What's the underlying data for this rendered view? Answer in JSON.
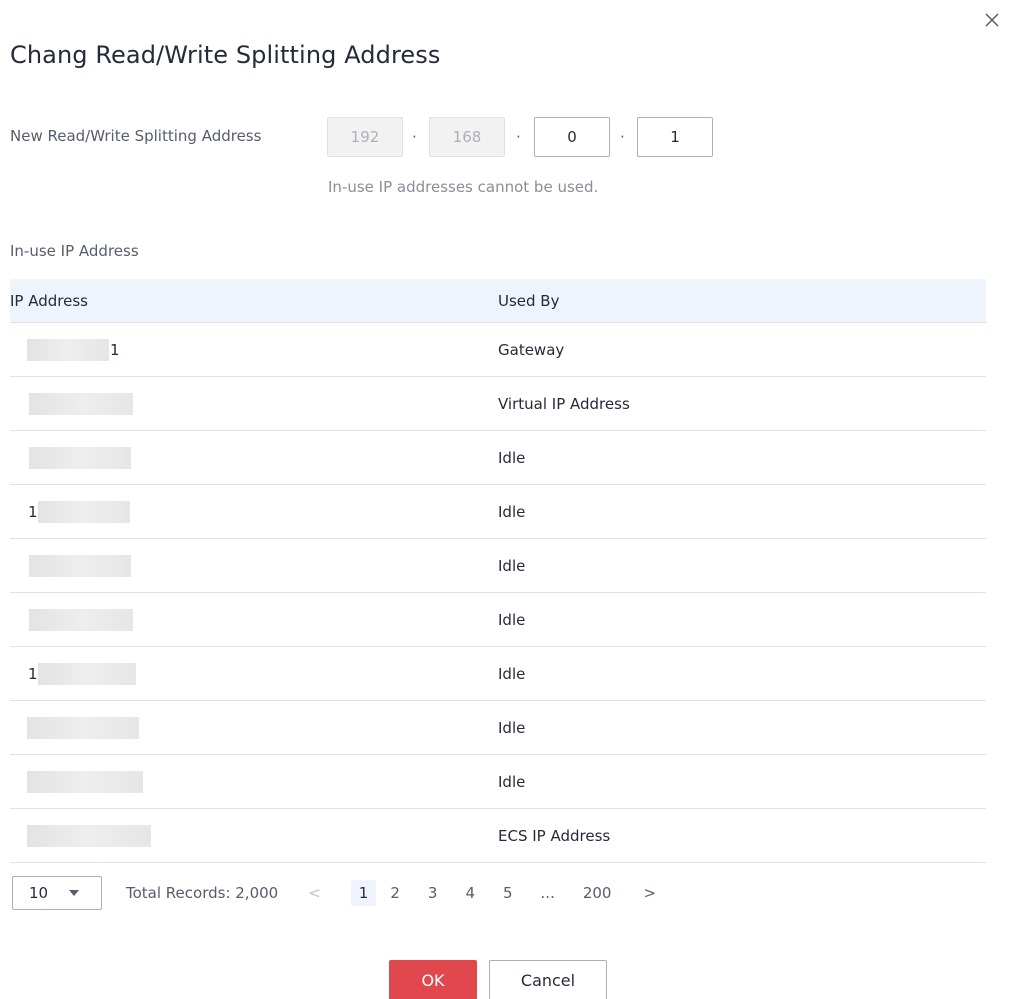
{
  "dialog": {
    "title": "Chang Read/Write Splitting Address",
    "close_icon": "close-icon"
  },
  "address_field": {
    "label": "New Read/Write Splitting Address",
    "octets": [
      "192",
      "168",
      "0",
      "1"
    ],
    "separator": "·",
    "hint": "In-use IP addresses cannot be used."
  },
  "inuse_section": {
    "label": "In-use IP Address"
  },
  "table": {
    "headers": [
      "IP Address",
      "Used By"
    ],
    "rows": [
      {
        "ip_visible": "1",
        "used_by": "Gateway"
      },
      {
        "ip_visible": "",
        "used_by": "Virtual IP Address"
      },
      {
        "ip_visible": "",
        "used_by": "Idle"
      },
      {
        "ip_visible": "1",
        "used_by": "Idle"
      },
      {
        "ip_visible": "",
        "used_by": "Idle"
      },
      {
        "ip_visible": "",
        "used_by": "Idle"
      },
      {
        "ip_visible": "1",
        "used_by": "Idle"
      },
      {
        "ip_visible": "",
        "used_by": "Idle"
      },
      {
        "ip_visible": "",
        "used_by": "Idle"
      },
      {
        "ip_visible": "",
        "used_by": "ECS IP Address"
      }
    ]
  },
  "pagination": {
    "page_size": "10",
    "total": "Total Records: 2,000",
    "prev": "<",
    "pages": [
      "1",
      "2",
      "3",
      "4",
      "5",
      "...",
      "200"
    ],
    "next": ">",
    "current": "1"
  },
  "buttons": {
    "ok": "OK",
    "cancel": "Cancel"
  },
  "colors": {
    "primary": "#e0484e",
    "header_bg": "#eef3fc"
  }
}
